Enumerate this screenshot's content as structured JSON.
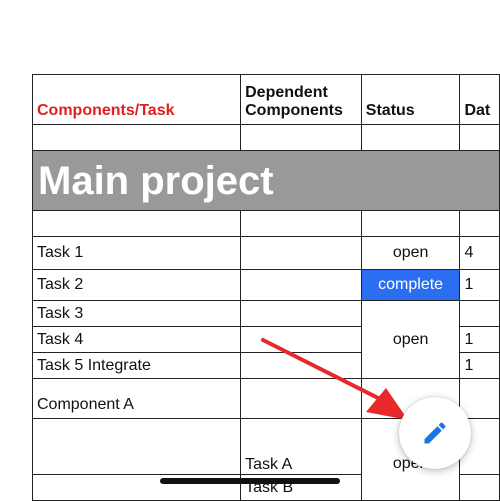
{
  "headers": {
    "components_task": "Components/Task",
    "dependent_line1": "Dependent",
    "dependent_line2": "Components",
    "status": "Status",
    "date_partial": "Dat"
  },
  "section_title": "Main project",
  "rows": [
    {
      "task": "Task 1",
      "dependent": "",
      "status": "open",
      "date_partial": "4"
    },
    {
      "task": "Task 2",
      "dependent": "",
      "status": "complete",
      "date_partial": "1"
    },
    {
      "task": "Task 3",
      "dependent": "",
      "status": "",
      "date_partial": ""
    },
    {
      "task": "Task 4",
      "dependent": "",
      "status": "open",
      "date_partial": "1"
    },
    {
      "task": "Task 5 Integrate",
      "dependent": "",
      "status": "",
      "date_partial": "1"
    },
    {
      "task": "Component A",
      "dependent": "",
      "status": "",
      "date_partial": ""
    },
    {
      "task": "",
      "dependent": "Task A",
      "status": "open",
      "date_partial": ""
    },
    {
      "task": "",
      "dependent": "Task B",
      "status": "",
      "date_partial": ""
    }
  ],
  "colors": {
    "header_accent": "#e0201f",
    "section_band": "#999999",
    "complete_fill": "#2c6ef2",
    "fab_icon": "#1a73e8",
    "arrow": "#e8282b"
  },
  "icons": {
    "fab": "pencil-icon",
    "annotation": "red-arrow-icon"
  }
}
